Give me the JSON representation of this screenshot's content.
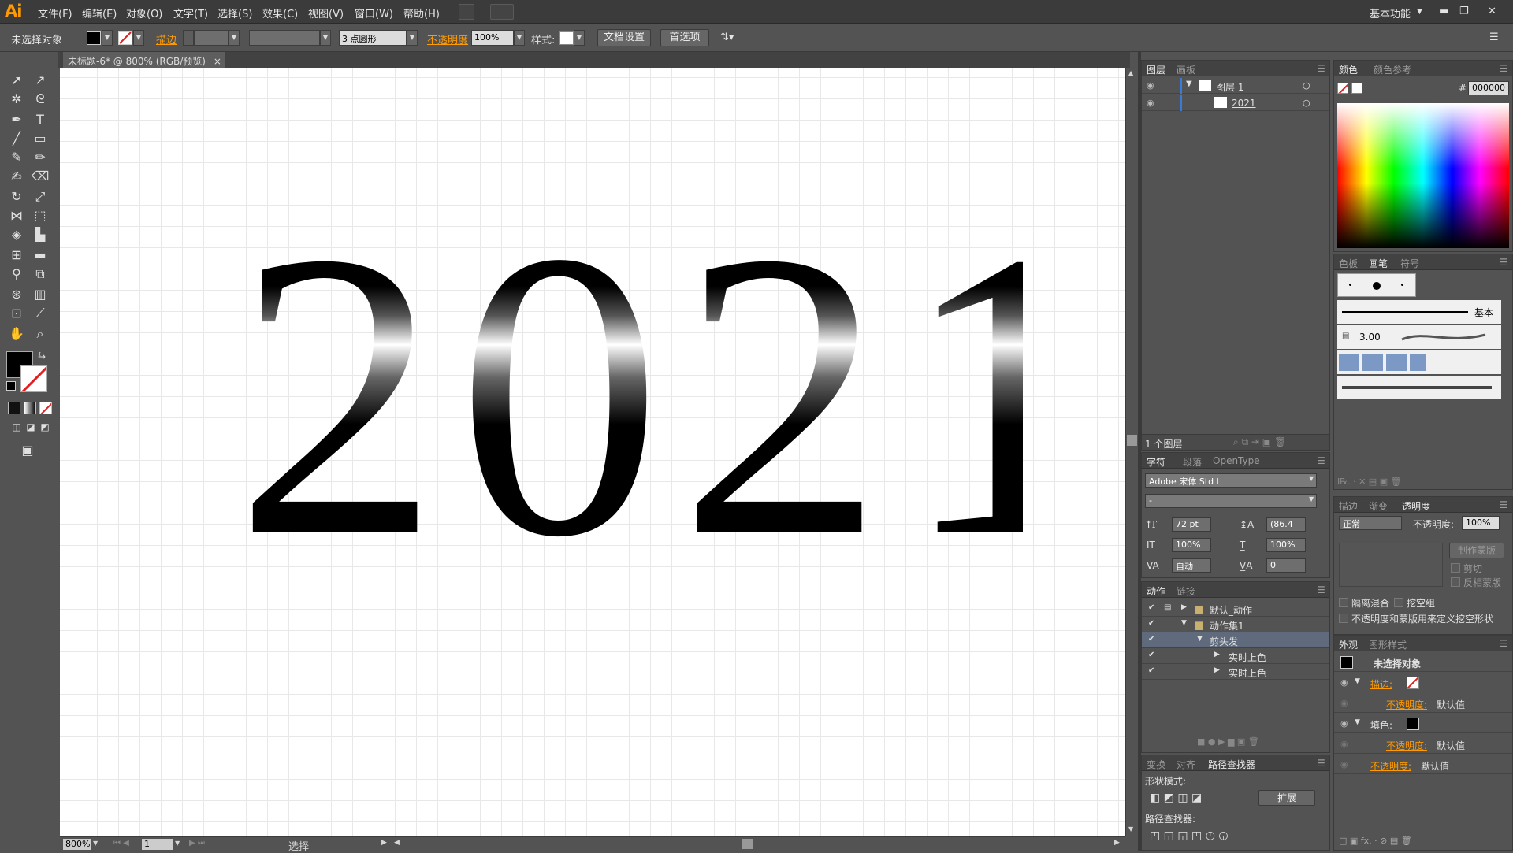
{
  "app": {
    "logo": "Ai",
    "workspace": "基本功能"
  },
  "menu": [
    "文件(F)",
    "编辑(E)",
    "对象(O)",
    "文字(T)",
    "选择(S)",
    "效果(C)",
    "视图(V)",
    "窗口(W)",
    "帮助(H)"
  ],
  "control_bar": {
    "selection": "未选择对象",
    "stroke_label": "描边",
    "brush": "3 点圆形",
    "opacity_label": "不透明度",
    "opacity_value": "100%",
    "style_label": "样式:",
    "doc_setup": "文档设置",
    "preferences": "首选项"
  },
  "document": {
    "tab_title": "未标题-6* @ 800% (RGB/预览)",
    "artwork_text": "2021",
    "gradient_colors": [
      "#000000",
      "#ffffff",
      "#000000"
    ]
  },
  "status": {
    "zoom": "800%",
    "page": "1",
    "mode": "选择"
  },
  "layers_panel": {
    "tabs": [
      "图层",
      "画板"
    ],
    "layers": [
      {
        "name": "图层 1"
      },
      {
        "name": "2021"
      }
    ],
    "footer": "1 个图层"
  },
  "character_panel": {
    "tabs": [
      "字符",
      "段落",
      "OpenType"
    ],
    "font_family": "Adobe 宋体 Std L",
    "font_style": "-",
    "size": "72 pt",
    "leading": "(86.4",
    "vscale": "100%",
    "hscale": "100%",
    "kerning": "自动",
    "tracking": "0"
  },
  "actions_panel": {
    "tabs": [
      "动作",
      "链接"
    ],
    "items": [
      {
        "label": "默认_动作"
      },
      {
        "label": "动作集1"
      },
      {
        "label": "剪头发"
      },
      {
        "label": "实时上色"
      },
      {
        "label": "实时上色"
      }
    ]
  },
  "pathfinder_panel": {
    "tabs": [
      "变换",
      "对齐",
      "路径查找器"
    ],
    "shape_modes": "形状模式:",
    "expand": "扩展",
    "pathfinders": "路径查找器:"
  },
  "color_panel": {
    "tabs": [
      "颜色",
      "颜色参考"
    ],
    "hex_label": "#",
    "hex": "000000"
  },
  "brushes_panel": {
    "tabs": [
      "色板",
      "画笔",
      "符号"
    ],
    "basic_label": "基本",
    "size": "3.00"
  },
  "transparency_panel": {
    "tabs": [
      "描边",
      "渐变",
      "透明度"
    ],
    "blend": "正常",
    "opacity_label": "不透明度:",
    "opacity_value": "100%",
    "make_mask": "制作蒙版",
    "clip": "剪切",
    "invert": "反相蒙版",
    "isolate": "隔离混合",
    "knockout": "挖空组",
    "opacity_mask_define": "不透明度和蒙版用来定义挖空形状"
  },
  "appearance_panel": {
    "tabs": [
      "外观",
      "图形样式"
    ],
    "title": "未选择对象",
    "stroke_label": "描边:",
    "opacity_label": "不透明度:",
    "default": "默认值",
    "fill_label": "填色:"
  }
}
